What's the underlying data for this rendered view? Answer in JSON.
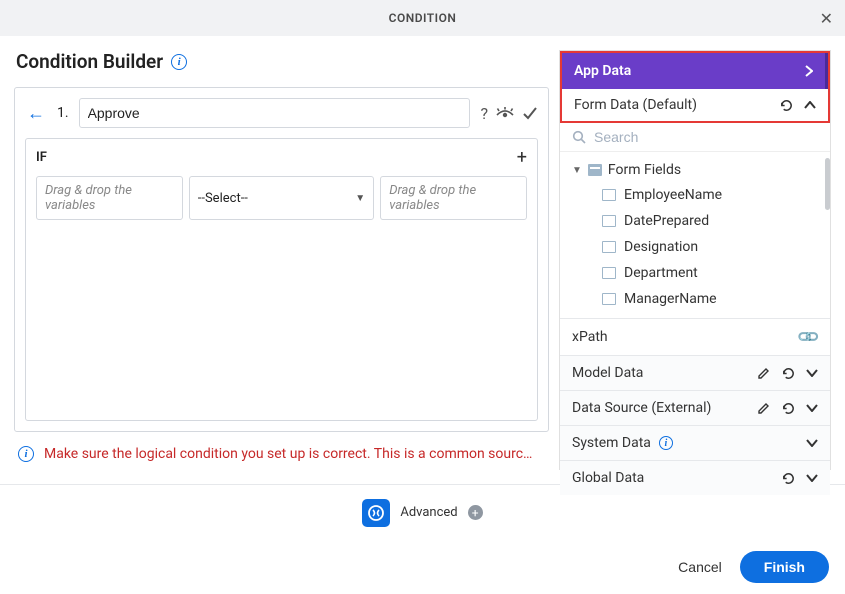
{
  "header": {
    "title": "CONDITION"
  },
  "builder": {
    "title": "Condition Builder",
    "row_number": "1.",
    "name_value": "Approve",
    "if_label": "IF",
    "dropzone_placeholder": "Drag & drop the variables",
    "select_placeholder": "--Select--",
    "warning": "Make sure the logical condition you set up is correct. This is a common sourc…"
  },
  "sidebar": {
    "app_data": "App Data",
    "form_data": "Form Data (Default)",
    "search_placeholder": "Search",
    "form_fields_label": "Form Fields",
    "fields": [
      "EmployeeName",
      "DatePrepared",
      "Designation",
      "Department",
      "ManagerName"
    ],
    "panels": {
      "xpath": "xPath",
      "model_data": "Model Data",
      "data_source": "Data Source (External)",
      "system_data": "System Data",
      "global_data": "Global Data"
    }
  },
  "advanced": {
    "label": "Advanced"
  },
  "footer": {
    "cancel": "Cancel",
    "finish": "Finish"
  }
}
